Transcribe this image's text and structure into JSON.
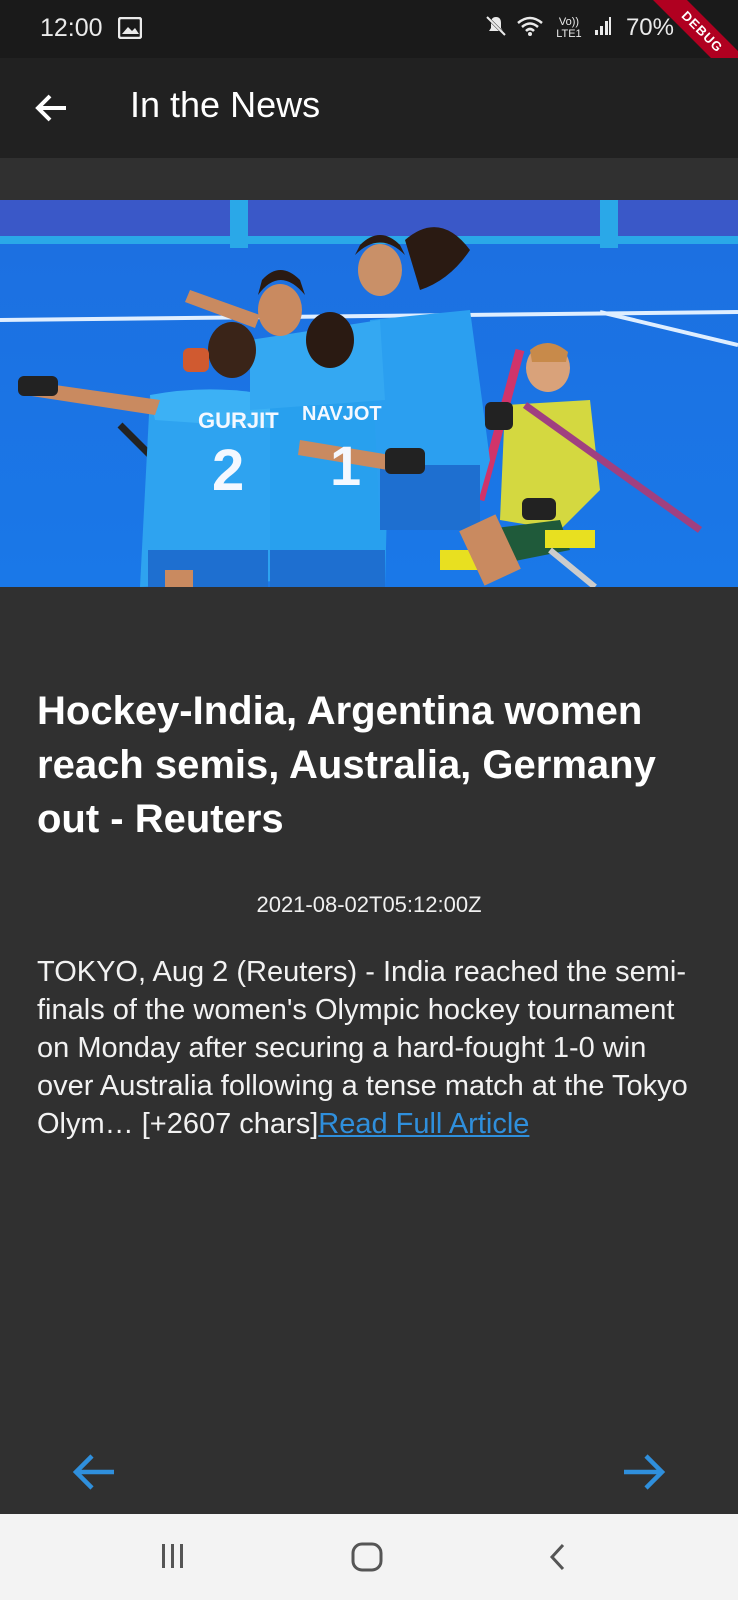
{
  "status_bar": {
    "time": "12:00",
    "signal_text": "Vo)) LTE1",
    "battery": "70%",
    "icons": [
      "gallery-icon",
      "mute-icon",
      "wifi-icon",
      "signal-icon",
      "battery-icon"
    ]
  },
  "debug_banner": "DEBUG",
  "app_bar": {
    "title": "In the News",
    "back_icon": "arrow-back-icon"
  },
  "article": {
    "title": "Hockey-India, Argentina women reach semis, Australia, Germany out - Reuters",
    "published_at": "2021-08-02T05:12:00Z",
    "description": "TOKYO, Aug 2 (Reuters) - India reached the semi-finals of the women's Olympic hockey tournament on Monday after securing a hard-fought 1-0 win over Australia following a tense match at the Tokyo Olym… [+2607 chars]",
    "link_label": "Read Full Article",
    "jersey_names": [
      "GURJIT",
      "NAVJOT"
    ],
    "jersey_numbers": [
      "2",
      "1"
    ]
  },
  "navigation": {
    "prev_icon": "arrow-left-icon",
    "next_icon": "arrow-right-icon"
  },
  "colors": {
    "background": "#303030",
    "app_bar": "#212121",
    "status_bar": "#1a1a1a",
    "accent": "#2f8fdc",
    "debug": "#b00020"
  }
}
